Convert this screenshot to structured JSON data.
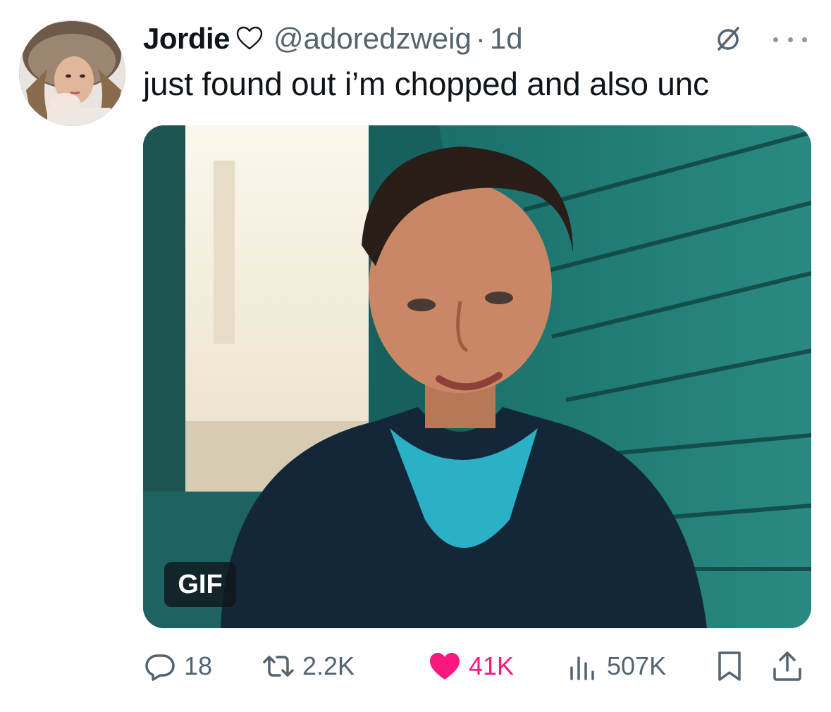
{
  "tweet": {
    "author_name": "Jordie",
    "handle": "@adoredzweig",
    "separator": "·",
    "time": "1d",
    "text": "just found out i’m chopped and also unc",
    "media_badge": "GIF"
  },
  "metrics": {
    "replies": "18",
    "retweets": "2.2K",
    "likes": "41K",
    "views": "507K"
  },
  "colors": {
    "text": "#0f1419",
    "secondary": "#536471",
    "like": "#f91880"
  },
  "icons": [
    "heart-outline-icon",
    "grok-icon",
    "more-icon",
    "reply-icon",
    "retweet-icon",
    "like-icon",
    "views-icon",
    "bookmark-icon",
    "share-icon"
  ]
}
